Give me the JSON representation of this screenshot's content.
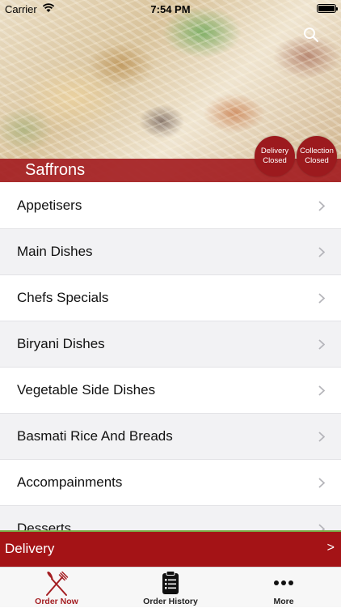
{
  "status_bar": {
    "carrier": "Carrier",
    "time": "7:54 PM"
  },
  "header": {
    "restaurant_name": "Saffrons",
    "delivery_status": {
      "line1": "Delivery",
      "line2": "Closed"
    },
    "collection_status": {
      "line1": "Collection",
      "line2": "Closed"
    }
  },
  "menu": {
    "items": [
      {
        "label": "Appetisers"
      },
      {
        "label": "Main Dishes"
      },
      {
        "label": "Chefs Specials"
      },
      {
        "label": "Biryani Dishes"
      },
      {
        "label": "Vegetable Side Dishes"
      },
      {
        "label": "Basmati Rice And Breads"
      },
      {
        "label": "Accompainments"
      },
      {
        "label": "Desserts"
      }
    ]
  },
  "order_bar": {
    "label": "Delivery",
    "arrow": ">"
  },
  "tab_bar": {
    "tabs": [
      {
        "label": "Order Now",
        "icon": "fork-knife-icon"
      },
      {
        "label": "Order History",
        "icon": "clipboard-icon"
      },
      {
        "label": "More",
        "icon": "ellipsis-icon"
      }
    ]
  },
  "colors": {
    "brand_red": "#a41e22",
    "accent_green": "#7aa843",
    "tab_bg": "#f7f7f7"
  }
}
